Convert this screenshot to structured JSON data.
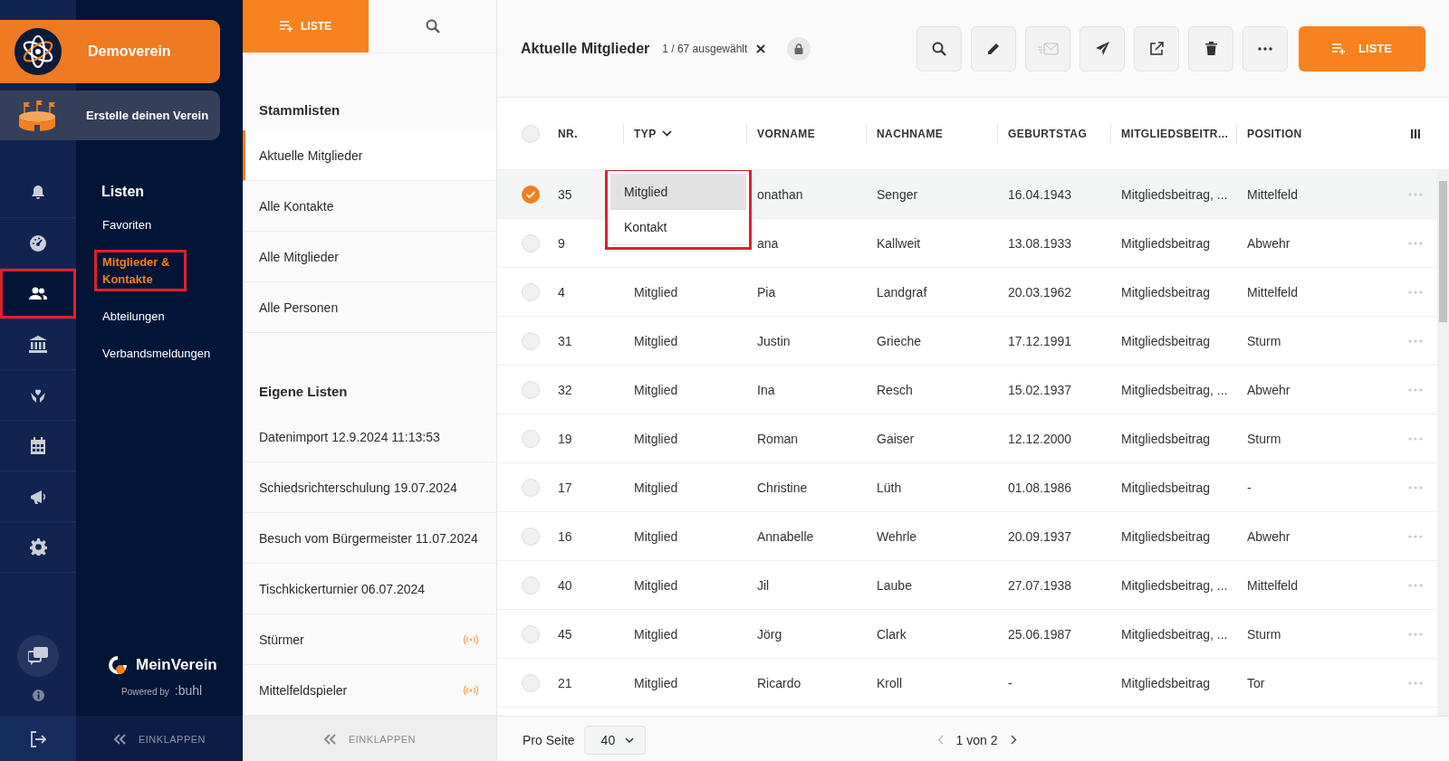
{
  "club": {
    "name": "Demoverein"
  },
  "create_club": {
    "label": "Erstelle deinen Verein"
  },
  "rail": {
    "items": [
      {
        "kind": "bell",
        "selected": false,
        "highlighted": false
      },
      {
        "kind": "gauge",
        "selected": false,
        "highlighted": false
      },
      {
        "kind": "people",
        "selected": true,
        "highlighted": true
      },
      {
        "kind": "bank",
        "selected": false,
        "highlighted": false
      },
      {
        "kind": "heart-hand",
        "selected": false,
        "highlighted": false
      },
      {
        "kind": "calendar",
        "selected": false,
        "highlighted": false
      },
      {
        "kind": "megaphone",
        "selected": false,
        "highlighted": false
      },
      {
        "kind": "gear",
        "selected": false,
        "highlighted": false
      }
    ]
  },
  "nav": {
    "heading": "Listen",
    "items": [
      {
        "label": "Favoriten",
        "selected": false,
        "highlighted": false
      },
      {
        "label": "Mitglieder & Kontakte",
        "selected": true,
        "highlighted": true
      },
      {
        "label": "Abteilungen",
        "selected": false,
        "highlighted": false
      },
      {
        "label": "Verbandsmeldungen",
        "selected": false,
        "highlighted": false
      }
    ],
    "brand": "MeinVerein",
    "powered_by": "Powered by",
    "vendor": ":buhl",
    "collapse": "EINKLAPPEN"
  },
  "lists_panel": {
    "tabs": [
      {
        "kind": "new-list",
        "label": "LISTE",
        "selected": true
      },
      {
        "kind": "search",
        "selected": false
      }
    ],
    "sections": [
      {
        "title": "Stammlisten",
        "items": [
          {
            "label": "Aktuelle Mitglieder",
            "selected": true,
            "live": false
          },
          {
            "label": "Alle Kontakte",
            "selected": false,
            "live": false
          },
          {
            "label": "Alle Mitglieder",
            "selected": false,
            "live": false
          },
          {
            "label": "Alle Personen",
            "selected": false,
            "live": false
          }
        ]
      },
      {
        "title": "Eigene Listen",
        "items": [
          {
            "label": "Datenimport 12.9.2024 11:13:53",
            "selected": false,
            "live": false
          },
          {
            "label": "Schiedsrichterschulung 19.07.2024",
            "selected": false,
            "live": false
          },
          {
            "label": "Besuch vom Bürgermeister 11.07.2024",
            "selected": false,
            "live": false
          },
          {
            "label": "Tischkickerturnier 06.07.2024",
            "selected": false,
            "live": false
          },
          {
            "label": "Stürmer",
            "selected": false,
            "live": true
          },
          {
            "label": "Mittelfeldspieler",
            "selected": false,
            "live": true
          }
        ]
      }
    ],
    "collapse": "EINKLAPPEN"
  },
  "main": {
    "title": "Aktuelle Mitglieder",
    "selection": "1 / 67 ausgewählt",
    "toolbar": [
      {
        "kind": "search",
        "disabled": false
      },
      {
        "kind": "pencil",
        "disabled": false
      },
      {
        "kind": "mail",
        "disabled": true
      },
      {
        "kind": "send",
        "disabled": false
      },
      {
        "kind": "external",
        "disabled": false
      },
      {
        "kind": "trash",
        "disabled": false
      },
      {
        "kind": "more",
        "disabled": false
      }
    ],
    "new_list_button": "LISTE"
  },
  "table": {
    "all_selected": false,
    "columns": [
      {
        "label": "NR.",
        "menu": false
      },
      {
        "label": "TYP",
        "menu": true
      },
      {
        "label": "VORNAME",
        "menu": false
      },
      {
        "label": "NACHNAME",
        "menu": false
      },
      {
        "label": "GEBURTSTAG",
        "menu": false
      },
      {
        "label": "MITGLIEDSBEITR...",
        "menu": false
      },
      {
        "label": "POSITION",
        "menu": false
      }
    ],
    "rows": [
      {
        "selected": true,
        "nr": "35",
        "vorname": "onathan",
        "nachname": "Senger",
        "geburtstag": "16.04.1943",
        "beitrag": "Mitgliedsbeitrag, ...",
        "position": "Mittelfeld"
      },
      {
        "selected": false,
        "nr": "9",
        "vorname": "ana",
        "nachname": "Kallweit",
        "geburtstag": "13.08.1933",
        "beitrag": "Mitgliedsbeitrag",
        "position": "Abwehr"
      },
      {
        "selected": false,
        "nr": "4",
        "typ": "Mitglied",
        "vorname": "Pia",
        "nachname": "Landgraf",
        "geburtstag": "20.03.1962",
        "beitrag": "Mitgliedsbeitrag",
        "position": "Mittelfeld"
      },
      {
        "selected": false,
        "nr": "31",
        "typ": "Mitglied",
        "vorname": "Justin",
        "nachname": "Grieche",
        "geburtstag": "17.12.1991",
        "beitrag": "Mitgliedsbeitrag",
        "position": "Sturm"
      },
      {
        "selected": false,
        "nr": "32",
        "typ": "Mitglied",
        "vorname": "Ina",
        "nachname": "Resch",
        "geburtstag": "15.02.1937",
        "beitrag": "Mitgliedsbeitrag, ...",
        "position": "Abwehr"
      },
      {
        "selected": false,
        "nr": "19",
        "typ": "Mitglied",
        "vorname": "Roman",
        "nachname": "Gaiser",
        "geburtstag": "12.12.2000",
        "beitrag": "Mitgliedsbeitrag",
        "position": "Sturm"
      },
      {
        "selected": false,
        "nr": "17",
        "typ": "Mitglied",
        "vorname": "Christine",
        "nachname": "Lüth",
        "geburtstag": "01.08.1986",
        "beitrag": "Mitgliedsbeitrag",
        "position": "-"
      },
      {
        "selected": false,
        "nr": "16",
        "typ": "Mitglied",
        "vorname": "Annabelle",
        "nachname": "Wehrle",
        "geburtstag": "20.09.1937",
        "beitrag": "Mitgliedsbeitrag",
        "position": "Abwehr"
      },
      {
        "selected": false,
        "nr": "40",
        "typ": "Mitglied",
        "vorname": "Jil",
        "nachname": "Laube",
        "geburtstag": "27.07.1938",
        "beitrag": "Mitgliedsbeitrag, ...",
        "position": "Mittelfeld"
      },
      {
        "selected": false,
        "nr": "45",
        "typ": "Mitglied",
        "vorname": "Jörg",
        "nachname": "Clark",
        "geburtstag": "25.06.1987",
        "beitrag": "Mitgliedsbeitrag, ...",
        "position": "Sturm"
      },
      {
        "selected": false,
        "nr": "21",
        "typ": "Mitglied",
        "vorname": "Ricardo",
        "nachname": "Kroll",
        "geburtstag": "-",
        "beitrag": "Mitgliedsbeitrag",
        "position": "Tor"
      }
    ]
  },
  "type_menu": {
    "highlighted": true,
    "options": [
      {
        "label": "Mitglied",
        "selected": true
      },
      {
        "label": "Kontakt",
        "selected": false
      }
    ]
  },
  "footer": {
    "per_page_label": "Pro Seite",
    "per_page": "40",
    "page": "1 von 2"
  }
}
